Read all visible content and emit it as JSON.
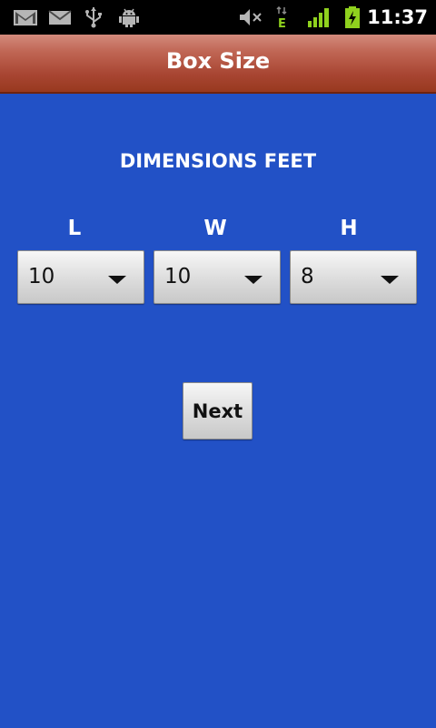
{
  "status_bar": {
    "time": "11:37",
    "icons": [
      "gmail-icon",
      "email-icon",
      "usb-icon",
      "android-debug-icon",
      "mute-icon",
      "edge-data-icon",
      "signal-icon",
      "battery-charging-icon"
    ]
  },
  "title_bar": {
    "title": "Box Size"
  },
  "form": {
    "heading": "DIMENSIONS FEET",
    "length": {
      "label": "L",
      "value": "10"
    },
    "width": {
      "label": "W",
      "value": "10"
    },
    "height": {
      "label": "H",
      "value": "8"
    },
    "next_label": "Next"
  },
  "colors": {
    "background": "#2251c6",
    "title_bar": "#b04a36",
    "status_icons_gray": "#b5b5b5",
    "status_icons_green": "#8fd11e"
  }
}
